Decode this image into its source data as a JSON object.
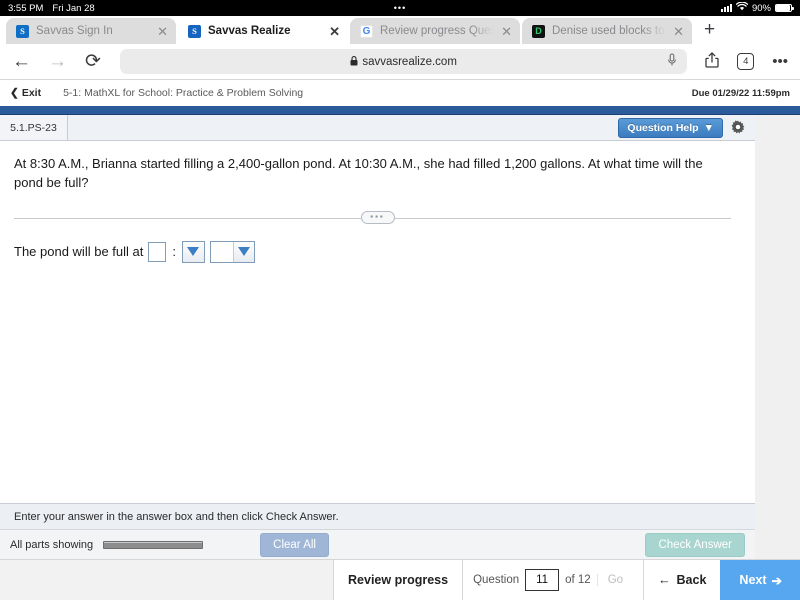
{
  "status_bar": {
    "time": "3:55 PM",
    "date": "Fri Jan 28",
    "center_dots": "•••",
    "battery_percent": "90%",
    "signal_icon": "cellular-signal-icon",
    "wifi_icon": "wifi-icon",
    "battery_icon": "battery-icon"
  },
  "browser": {
    "tabs": [
      {
        "title": "Savvas Sign In",
        "favicon": "savvas-icon",
        "favicon_text": "S",
        "active": false,
        "close_icon": "✕"
      },
      {
        "title": "Savvas Realize",
        "favicon": "savvas-icon",
        "favicon_text": "S",
        "active": true,
        "close_icon": "✕"
      },
      {
        "title": "Review progress Questio",
        "favicon": "google-icon",
        "favicon_text": "G",
        "active": false,
        "close_icon": "✕"
      },
      {
        "title": "Denise used blocks to ma",
        "favicon": "document-icon",
        "favicon_text": "D",
        "active": false,
        "close_icon": "✕"
      }
    ],
    "new_tab_label": "+",
    "back_icon": "←",
    "forward_icon": "→",
    "reload_icon": "⟳",
    "url": "savvasrealize.com",
    "lock_icon": "🔒",
    "mic_icon": "mic-icon",
    "share_icon": "share-icon",
    "tab_count": "4",
    "more_icon": "•••"
  },
  "app_header": {
    "exit_label": "Exit",
    "exit_chevron": "❮",
    "assignment_title": "5-1: MathXL for School: Practice & Problem Solving",
    "due_text": "Due 01/29/22 11:59pm"
  },
  "question_panel": {
    "question_id": "5.1.PS-23",
    "question_help_label": "Question Help",
    "question_help_caret": "▼",
    "settings_icon": "gear-icon",
    "question_text": "At 8:30 A.M., Brianna started filling a 2,400-gallon pond. At 10:30 A.M., she had filled 1,200 gallons. At what time will the pond be full?",
    "divider_handle_dots": "▪▪▪",
    "answer_prompt": "The pond will be full at",
    "answer_value": "",
    "answer_separator": ":",
    "minutes_dropdown_value": "",
    "ampm_dropdown_value": "",
    "dropdown_caret": "▼",
    "hint_text": "Enter your answer in the answer box and then click Check Answer.",
    "parts_status": "All parts showing",
    "clear_all_label": "Clear All",
    "check_answer_label": "Check Answer"
  },
  "bottom_nav": {
    "review_progress_label": "Review progress",
    "question_label": "Question",
    "question_number": "11",
    "of_label": "of 12",
    "go_label": "Go",
    "back_label": "Back",
    "back_arrow": "←",
    "next_label": "Next",
    "next_arrow": "➔"
  },
  "colors": {
    "accent_blue": "#2c5b9b",
    "next_button_blue": "#56a7f0",
    "question_help_blue": "#3c7cc0",
    "check_answer_teal": "#a8d5cf",
    "clear_all_blue": "#9fb6d6"
  }
}
